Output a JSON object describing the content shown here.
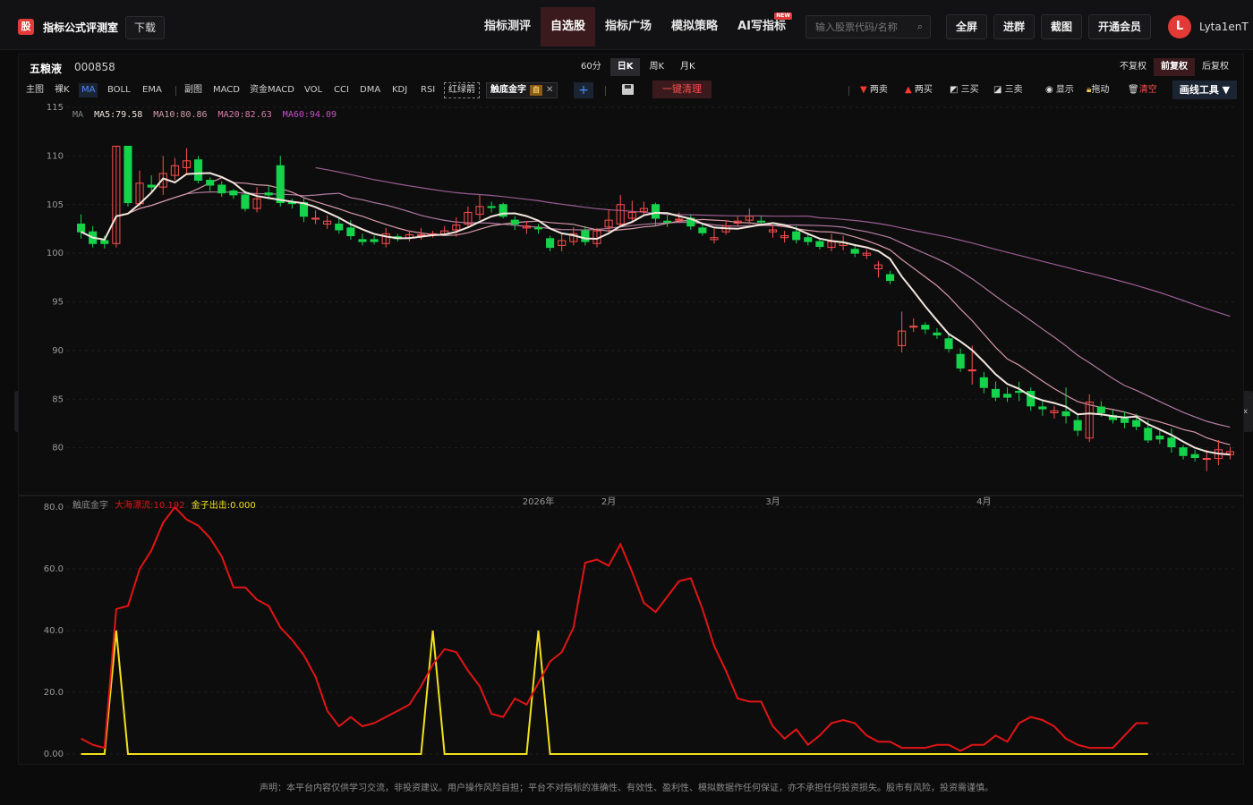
{
  "topbar": {
    "logo_char": "股",
    "brand": "指标公式评测室",
    "download": "下载",
    "nav": [
      {
        "label": "指标测评",
        "active": false
      },
      {
        "label": "自选股",
        "active": true
      },
      {
        "label": "指标广场",
        "active": false
      },
      {
        "label": "模拟策略",
        "active": false
      },
      {
        "label": "AI写指标",
        "active": false,
        "badge": "NEW"
      }
    ],
    "search_placeholder": "输入股票代码/名称",
    "buttons": [
      "全屏",
      "进群",
      "截图",
      "开通会员"
    ],
    "avatar_letter": "L",
    "username": "Lyta1enT"
  },
  "stock": {
    "name": "五粮液",
    "code": "000858"
  },
  "periods": [
    {
      "label": "60分",
      "active": false
    },
    {
      "label": "日K",
      "active": true
    },
    {
      "label": "周K",
      "active": false
    },
    {
      "label": "月K",
      "active": false
    }
  ],
  "adjust": [
    {
      "label": "不复权",
      "active": false
    },
    {
      "label": "前复权",
      "active": true
    },
    {
      "label": "后复权",
      "active": false
    }
  ],
  "indicators": {
    "main_label": "主图",
    "main": [
      "裸K",
      "MA",
      "BOLL",
      "EMA"
    ],
    "sub_label": "副图",
    "sub": [
      "MACD",
      "资金MACD",
      "VOL",
      "CCI",
      "DMA",
      "KDJ",
      "RSI"
    ],
    "hongjian": "红绿箭",
    "active_custom": "触底金字",
    "custom_tag": "自",
    "clear_btn": "一键清理"
  },
  "tools": {
    "items": [
      "两卖",
      "两买",
      "三买",
      "三卖",
      "显示",
      "拖动",
      "清空"
    ],
    "draw": "画线工具 ▼"
  },
  "ma_legend": {
    "name": "MA",
    "ma5": "MA5:79.58",
    "ma10": "MA10:80.86",
    "ma20": "MA20:82.63",
    "ma60": "MA60:94.09"
  },
  "sub_legend": {
    "name": "触底金字",
    "flow": "大海漂流:10.192",
    "golden": "金子出击:0.000"
  },
  "colors": {
    "up": "#ff4d4d",
    "down": "#15d34a",
    "ma5": "#f2e6dc",
    "ma10": "#d79aa8",
    "ma20": "#b07ba0",
    "ma60": "#9a5c92",
    "flow": "#e21414",
    "golden": "#f1e11a"
  },
  "chart_data": {
    "type": "candlestick",
    "main_y_ticks": [
      "115",
      "110",
      "105",
      "100",
      "95",
      "90",
      "85",
      "80"
    ],
    "ylim": [
      75,
      115
    ],
    "x_labels": [
      "2026年",
      "2月",
      "3月",
      "4月"
    ],
    "candles": [
      [
        103.0,
        102.2,
        104.0,
        101.5
      ],
      [
        102.2,
        101.0,
        102.8,
        100.6
      ],
      [
        101.3,
        101.0,
        101.8,
        100.5
      ],
      [
        101.0,
        111.0,
        111.0,
        100.6
      ],
      [
        111.0,
        105.2,
        111.0,
        104.8
      ],
      [
        105.1,
        107.2,
        108.5,
        104.8
      ],
      [
        107.0,
        106.8,
        108.0,
        106.2
      ],
      [
        106.8,
        108.2,
        110.0,
        106.0
      ],
      [
        108.0,
        109.0,
        109.8,
        107.5
      ],
      [
        108.8,
        109.5,
        110.8,
        108.2
      ],
      [
        109.6,
        107.5,
        110.0,
        107.2
      ],
      [
        107.5,
        107.0,
        107.8,
        106.4
      ],
      [
        107.0,
        106.2,
        107.4,
        105.8
      ],
      [
        106.4,
        106.0,
        106.6,
        105.6
      ],
      [
        106.0,
        104.6,
        106.4,
        104.3
      ],
      [
        104.6,
        105.6,
        106.8,
        104.2
      ],
      [
        106.2,
        106.0,
        107.0,
        105.6
      ],
      [
        109.0,
        105.2,
        110.0,
        104.8
      ],
      [
        105.2,
        105.1,
        105.6,
        104.6
      ],
      [
        105.2,
        103.8,
        105.6,
        103.2
      ],
      [
        103.6,
        103.6,
        104.4,
        103.0
      ],
      [
        103.0,
        103.3,
        103.9,
        102.5
      ],
      [
        103.0,
        102.4,
        103.6,
        102.0
      ],
      [
        102.6,
        101.8,
        103.4,
        101.4
      ],
      [
        101.4,
        101.2,
        102.0,
        100.8
      ],
      [
        101.4,
        101.2,
        101.8,
        100.9
      ],
      [
        101.0,
        102.0,
        102.6,
        100.6
      ],
      [
        101.7,
        101.5,
        102.0,
        101.2
      ],
      [
        101.6,
        101.9,
        102.3,
        101.2
      ],
      [
        101.8,
        101.9,
        102.6,
        101.4
      ],
      [
        102.0,
        102.0,
        102.3,
        101.6
      ],
      [
        102.0,
        102.3,
        102.8,
        101.8
      ],
      [
        102.4,
        102.9,
        103.7,
        101.7
      ],
      [
        103.0,
        104.2,
        104.8,
        102.6
      ],
      [
        104.0,
        104.8,
        106.0,
        103.4
      ],
      [
        104.8,
        104.7,
        105.3,
        104.2
      ],
      [
        105.0,
        103.8,
        105.2,
        103.6
      ],
      [
        103.4,
        103.0,
        103.8,
        102.4
      ],
      [
        102.6,
        102.8,
        103.3,
        102.0
      ],
      [
        102.6,
        102.5,
        103.0,
        102.0
      ],
      [
        101.5,
        100.6,
        101.8,
        100.2
      ],
      [
        100.8,
        101.3,
        102.0,
        100.2
      ],
      [
        101.2,
        102.0,
        102.7,
        100.8
      ],
      [
        102.3,
        101.2,
        102.8,
        100.8
      ],
      [
        101.0,
        102.3,
        102.6,
        100.6
      ],
      [
        102.7,
        103.4,
        104.5,
        102.2
      ],
      [
        103.0,
        105.0,
        106.0,
        102.8
      ],
      [
        103.6,
        104.2,
        105.4,
        103.2
      ],
      [
        104.3,
        104.6,
        105.3,
        103.9
      ],
      [
        105.0,
        103.6,
        105.2,
        102.8
      ],
      [
        103.3,
        103.2,
        103.9,
        102.7
      ],
      [
        103.4,
        103.5,
        104.2,
        103.1
      ],
      [
        103.6,
        102.8,
        104.0,
        102.4
      ],
      [
        102.6,
        102.1,
        103.1,
        101.8
      ],
      [
        101.4,
        101.6,
        102.5,
        101.0
      ],
      [
        102.2,
        102.8,
        103.4,
        101.9
      ],
      [
        103.1,
        103.3,
        103.8,
        102.8
      ],
      [
        103.4,
        103.8,
        104.6,
        103.0
      ],
      [
        103.3,
        103.2,
        103.8,
        102.9
      ],
      [
        102.2,
        102.4,
        102.9,
        101.6
      ],
      [
        101.6,
        101.8,
        102.3,
        101.1
      ],
      [
        102.2,
        101.4,
        102.8,
        101.0
      ],
      [
        101.6,
        101.2,
        102.0,
        100.8
      ],
      [
        101.2,
        100.7,
        101.5,
        100.4
      ],
      [
        100.6,
        101.2,
        102.0,
        100.2
      ],
      [
        100.8,
        101.1,
        101.8,
        100.3
      ],
      [
        100.4,
        100.0,
        100.8,
        99.6
      ],
      [
        99.8,
        100.0,
        100.4,
        99.4
      ],
      [
        98.4,
        98.8,
        99.2,
        97.5
      ],
      [
        97.8,
        97.2,
        98.2,
        96.8
      ],
      [
        90.5,
        92.0,
        94.0,
        89.8
      ],
      [
        92.4,
        92.5,
        93.3,
        91.9
      ],
      [
        92.6,
        92.2,
        92.9,
        91.7
      ],
      [
        91.8,
        91.6,
        92.3,
        91.2
      ],
      [
        91.2,
        90.2,
        91.8,
        89.8
      ],
      [
        89.6,
        88.2,
        90.2,
        87.8
      ],
      [
        88.0,
        88.0,
        90.5,
        86.5
      ],
      [
        87.2,
        86.2,
        87.8,
        85.6
      ],
      [
        86.0,
        85.2,
        86.8,
        84.8
      ],
      [
        85.5,
        85.2,
        86.2,
        84.7
      ],
      [
        85.8,
        85.7,
        86.8,
        84.8
      ],
      [
        85.8,
        84.3,
        86.2,
        83.8
      ],
      [
        84.2,
        84.0,
        84.8,
        83.3
      ],
      [
        83.6,
        83.8,
        84.3,
        83.0
      ],
      [
        83.7,
        83.3,
        86.2,
        82.5
      ],
      [
        82.8,
        81.8,
        83.4,
        81.2
      ],
      [
        81.0,
        84.7,
        85.5,
        80.6
      ],
      [
        84.2,
        83.6,
        84.8,
        83.2
      ],
      [
        83.3,
        82.9,
        83.9,
        82.5
      ],
      [
        83.0,
        82.6,
        83.7,
        82.0
      ],
      [
        82.8,
        82.2,
        83.5,
        81.8
      ],
      [
        82.0,
        80.8,
        82.8,
        80.5
      ],
      [
        81.2,
        80.9,
        81.8,
        80.4
      ],
      [
        81.0,
        80.1,
        82.0,
        79.5
      ],
      [
        80.0,
        79.2,
        80.3,
        78.8
      ],
      [
        79.3,
        79.0,
        79.8,
        78.6
      ],
      [
        78.9,
        78.9,
        79.8,
        77.6
      ],
      [
        78.9,
        79.8,
        80.8,
        78.2
      ],
      [
        79.3,
        79.6,
        80.1,
        78.8
      ]
    ],
    "sub_y_ticks": [
      "80.0",
      "60.0",
      "40.0",
      "20.0",
      "0.00"
    ],
    "sub_ylim": [
      0,
      80
    ],
    "sub_series": [
      {
        "name": "大海漂流",
        "values": [
          5,
          3,
          2,
          47,
          48,
          60,
          66,
          75,
          80,
          76,
          74,
          70,
          64,
          54,
          54,
          50,
          48,
          41,
          37,
          32,
          25,
          14,
          9,
          12,
          9,
          10,
          12,
          14,
          16,
          22,
          29,
          34,
          33,
          27,
          22,
          13,
          12,
          18,
          16,
          23,
          30,
          33,
          41,
          62,
          63,
          61,
          68,
          59,
          49,
          46,
          51,
          56,
          57,
          47,
          35,
          27,
          18,
          17,
          17,
          9,
          5,
          8,
          3,
          6,
          10,
          11,
          10,
          6,
          4,
          4,
          2,
          2,
          2,
          3,
          3,
          1,
          3,
          3,
          6,
          4,
          10,
          12,
          11,
          9,
          5,
          3,
          2,
          2,
          2,
          6,
          10,
          10
        ]
      },
      {
        "name": "金子出击",
        "values": [
          0,
          0,
          0,
          40,
          0,
          0,
          0,
          0,
          0,
          0,
          0,
          0,
          0,
          0,
          0,
          0,
          0,
          0,
          0,
          0,
          0,
          0,
          0,
          0,
          0,
          0,
          0,
          0,
          0,
          0,
          40,
          0,
          0,
          0,
          0,
          0,
          0,
          0,
          0,
          40,
          0,
          0,
          0,
          0,
          0,
          0,
          0,
          0,
          0,
          0,
          0,
          0,
          0,
          0,
          0,
          0,
          0,
          0,
          0,
          0,
          0,
          0,
          0,
          0,
          0,
          0,
          0,
          0,
          0,
          0,
          0,
          0,
          0,
          0,
          0,
          0,
          0,
          0,
          0,
          0,
          0,
          0,
          0,
          0,
          0,
          0,
          0,
          0,
          0,
          0,
          0,
          0
        ]
      }
    ]
  },
  "footer": "声明：本平台内容仅供学习交流，非投资建议。用户操作风险自担；平台不对指标的准确性、有效性、盈利性、模拟数据作任何保证，亦不承担任何投资损失。股市有风险，投资需谨慎。"
}
